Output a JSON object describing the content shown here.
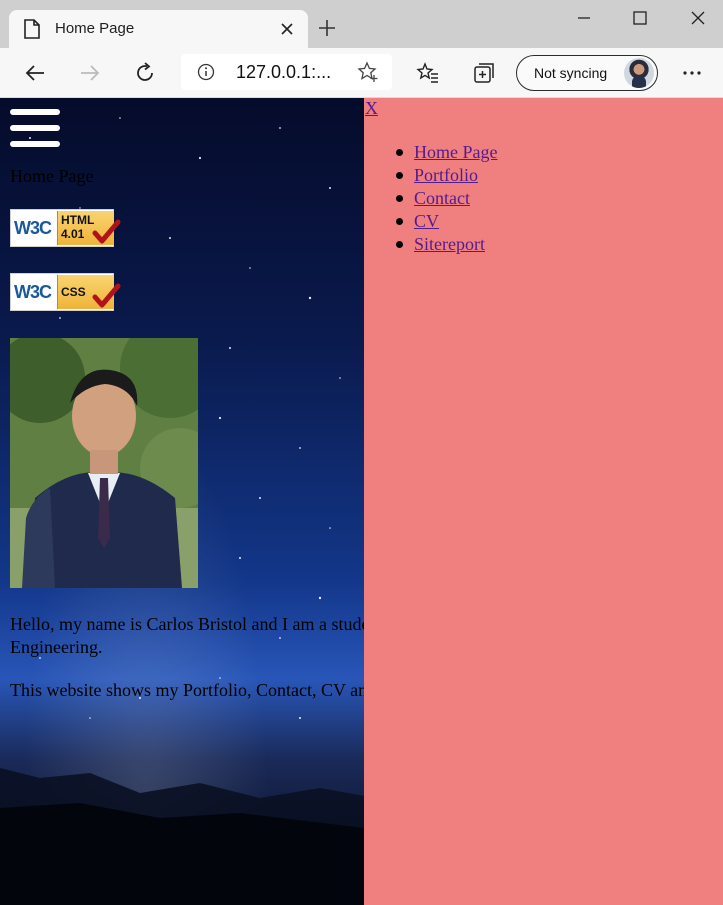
{
  "browser": {
    "tab_title": "Home Page",
    "address": "127.0.0.1:...",
    "sync_label": "Not syncing",
    "icons": [
      "page-icon",
      "close-icon",
      "plus-icon",
      "minimize-icon",
      "maximize-icon",
      "window-close-icon",
      "back-arrow-icon",
      "forward-arrow-icon",
      "refresh-icon",
      "info-icon",
      "star-add-icon",
      "favorites-icon",
      "collections-icon",
      "more-icon"
    ]
  },
  "page": {
    "title": "Home Page",
    "badges": {
      "html": {
        "brand": "W3C",
        "text": "HTML\n4.01"
      },
      "css": {
        "brand": "W3C",
        "text": "CSS"
      }
    },
    "bio_line1": "Hello, my name is Carlos Bristol and I am a student in Software",
    "bio_line2": "Engineering.",
    "bio_line3": "This website shows my Portfolio, Contact, CV and Sitereport."
  },
  "sidenav": {
    "close_label": "X",
    "items": [
      {
        "label": "Home Page"
      },
      {
        "label": "Portfolio"
      },
      {
        "label": "Contact"
      },
      {
        "label": "CV"
      },
      {
        "label": "Sitereport"
      }
    ],
    "background": "#f08080",
    "link_color": "#551a8b"
  }
}
